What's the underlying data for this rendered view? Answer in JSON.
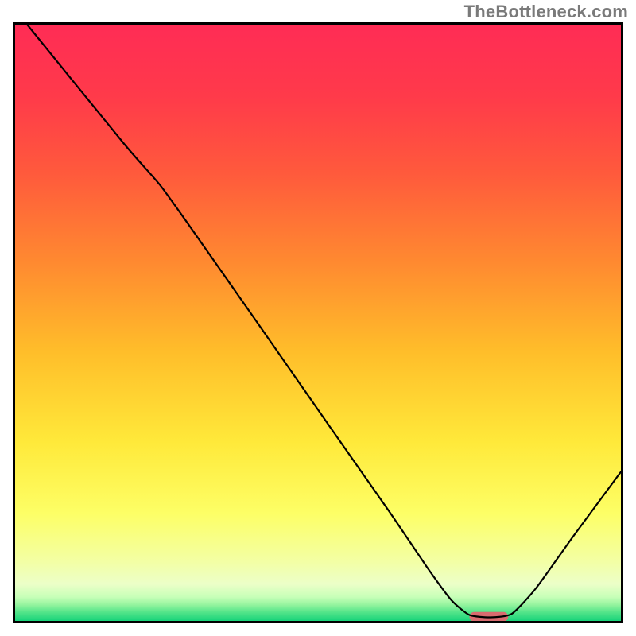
{
  "watermark": "TheBottleneck.com",
  "chart_data": {
    "type": "line",
    "title": "",
    "xlabel": "",
    "ylabel": "",
    "xlim": [
      0,
      100
    ],
    "ylim": [
      0,
      100
    ],
    "background_gradient": {
      "stops": [
        {
          "offset": 0.0,
          "color": "#ff2c55"
        },
        {
          "offset": 0.12,
          "color": "#ff3a4a"
        },
        {
          "offset": 0.25,
          "color": "#ff5a3c"
        },
        {
          "offset": 0.4,
          "color": "#ff8a30"
        },
        {
          "offset": 0.55,
          "color": "#ffbe2a"
        },
        {
          "offset": 0.7,
          "color": "#ffe93a"
        },
        {
          "offset": 0.82,
          "color": "#fdff66"
        },
        {
          "offset": 0.9,
          "color": "#f3ffa4"
        },
        {
          "offset": 0.938,
          "color": "#ecffc8"
        },
        {
          "offset": 0.96,
          "color": "#c7ffb8"
        },
        {
          "offset": 0.972,
          "color": "#99f5a0"
        },
        {
          "offset": 0.985,
          "color": "#55e58a"
        },
        {
          "offset": 1.0,
          "color": "#17d37a"
        }
      ]
    },
    "series": [
      {
        "name": "bottleneck-curve",
        "color": "#000000",
        "width": 2.2,
        "points": [
          {
            "x": 2.0,
            "y": 100.0
          },
          {
            "x": 18.0,
            "y": 80.0
          },
          {
            "x": 24.0,
            "y": 73.0
          },
          {
            "x": 30.0,
            "y": 64.5
          },
          {
            "x": 40.0,
            "y": 50.0
          },
          {
            "x": 52.0,
            "y": 32.5
          },
          {
            "x": 62.0,
            "y": 18.0
          },
          {
            "x": 68.0,
            "y": 9.0
          },
          {
            "x": 72.0,
            "y": 3.5
          },
          {
            "x": 75.0,
            "y": 1.0
          },
          {
            "x": 78.5,
            "y": 0.6
          },
          {
            "x": 82.0,
            "y": 1.2
          },
          {
            "x": 86.0,
            "y": 5.5
          },
          {
            "x": 92.0,
            "y": 14.0
          },
          {
            "x": 100.0,
            "y": 25.0
          }
        ]
      }
    ],
    "marker": {
      "name": "optimal-range",
      "shape": "pill",
      "color": "#d86b6f",
      "x_center": 78.2,
      "y": 0.7,
      "width_x_units": 6.4,
      "height_y_units": 1.6
    },
    "axes": {
      "show_ticks": false,
      "show_grid": false,
      "frame_color": "#000000",
      "frame_width": 3
    }
  }
}
